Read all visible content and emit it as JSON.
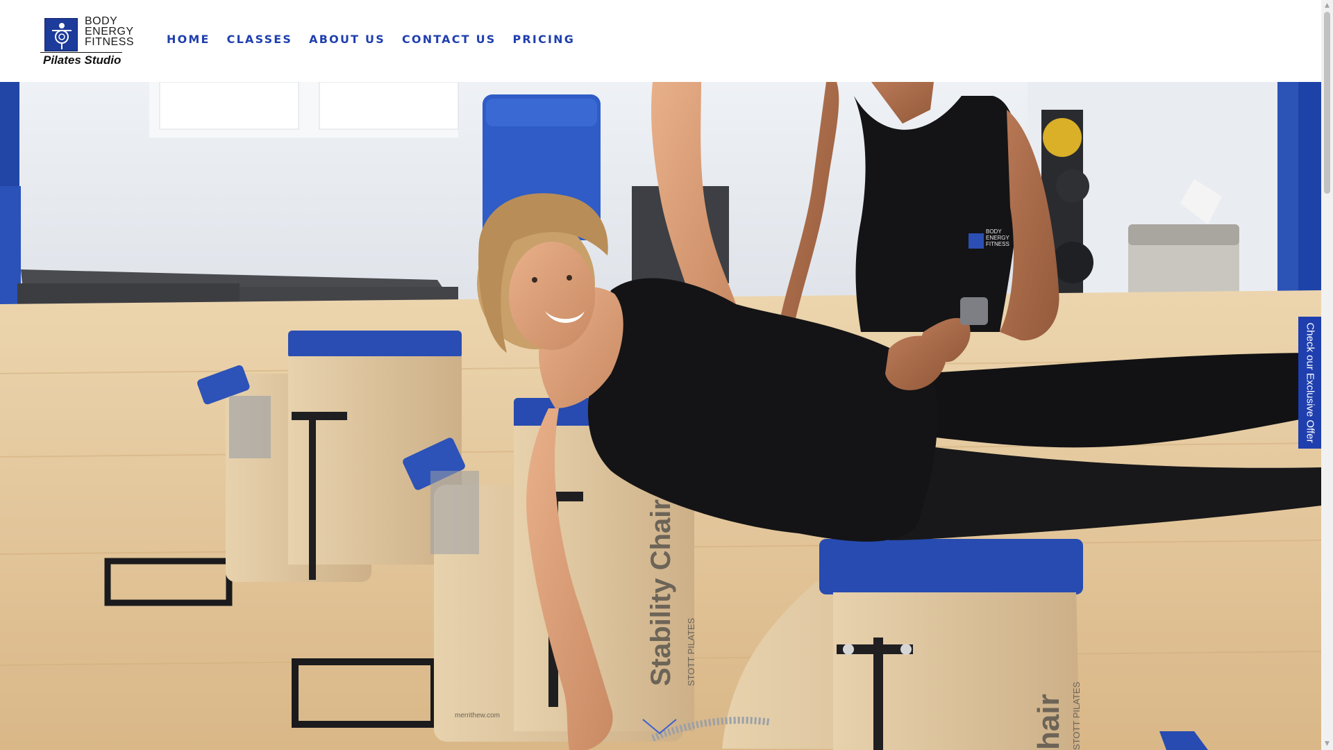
{
  "logo": {
    "wordmark": [
      "BODY",
      "ENERGY",
      "FITNESS"
    ],
    "subtitle": "Pilates Studio"
  },
  "nav": {
    "items": [
      {
        "label": "HOME"
      },
      {
        "label": "CLASSES"
      },
      {
        "label": "ABOUT US"
      },
      {
        "label": "CONTACT US"
      },
      {
        "label": "PRICING"
      }
    ]
  },
  "hero": {
    "image": "pilates-studio-photo",
    "equipment_labels": {
      "chair_brand": "Stability Chair",
      "chair_maker": "STOTT PILATES",
      "chair_partial": "hair",
      "chair_maker_partial": "STOTT PILATES",
      "website": "merrithew.com"
    },
    "shirt_logo": [
      "BODY",
      "ENERGY",
      "FITNESS"
    ]
  },
  "offer_tab": {
    "label": "Check our Exclusive Offer"
  },
  "scroll_indicator": {
    "icon": "chevron-down-icon"
  },
  "colors": {
    "nav_blue": "#1f3fae",
    "offer_tab": "#1f3fae",
    "chair_pad_blue": "#274bb0",
    "floor_wood": "#e2c59a"
  }
}
